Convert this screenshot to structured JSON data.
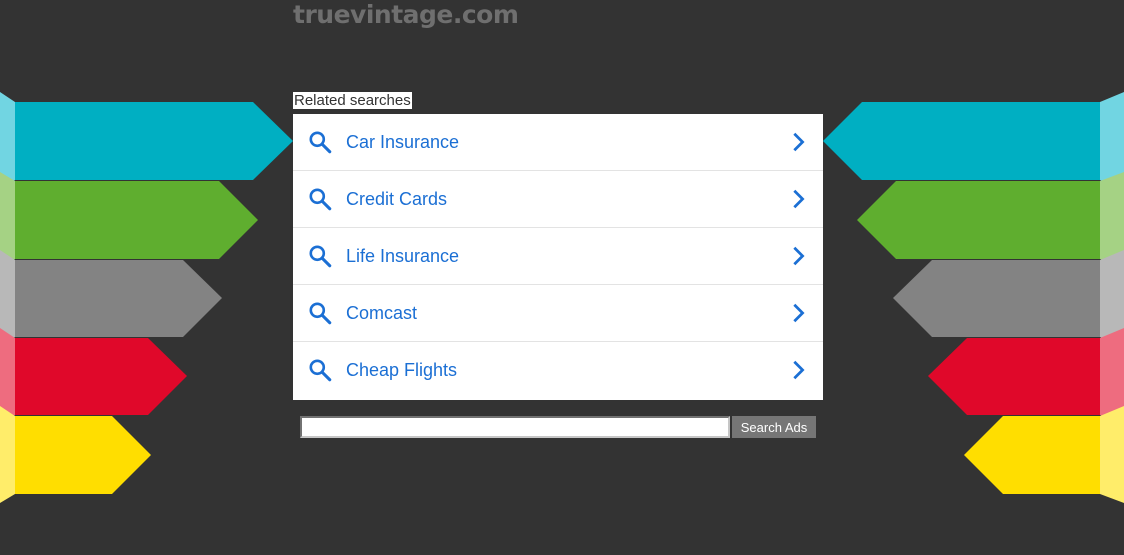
{
  "header": {
    "site_title": "truevintage.com"
  },
  "related": {
    "label": "Related searches",
    "items": [
      {
        "label": "Car Insurance"
      },
      {
        "label": "Credit Cards"
      },
      {
        "label": "Life Insurance"
      },
      {
        "label": "Comcast"
      },
      {
        "label": "Cheap Flights"
      }
    ]
  },
  "search_form": {
    "input_value": "",
    "button_label": "Search Ads"
  },
  "colors": {
    "background": "#333333",
    "link": "#1b6fd4",
    "teal": "#00afc2",
    "green": "#5fae2f",
    "gray": "#838383",
    "red": "#e0082a",
    "yellow": "#ffde00"
  },
  "icons": {
    "result_icon": "search-icon",
    "result_arrow": "chevron-right-icon"
  }
}
